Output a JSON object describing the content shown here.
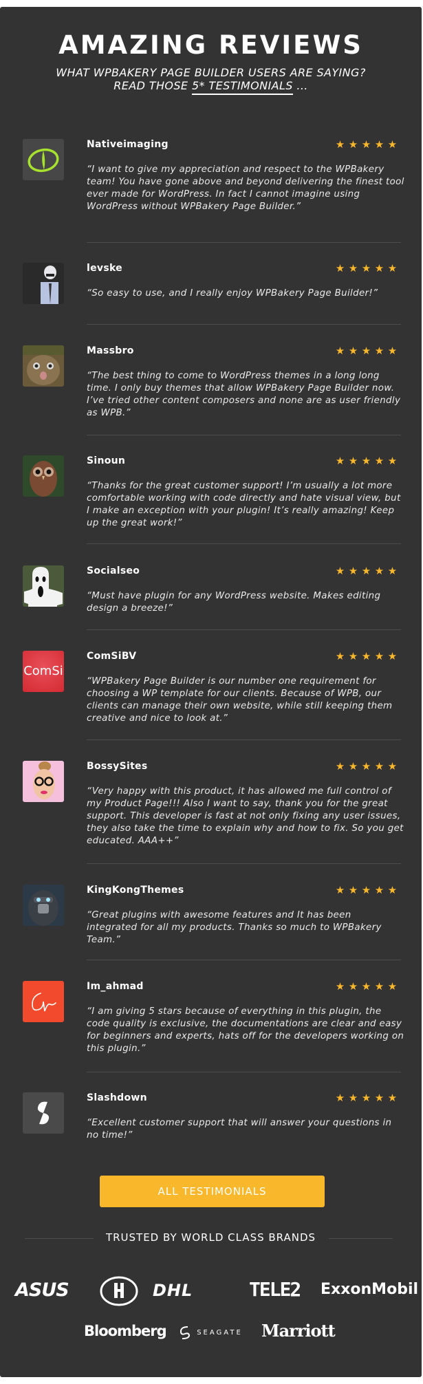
{
  "header": {
    "title": "AMAZING REVIEWS",
    "subtitle_line1": "WHAT WPBAKERY PAGE BUILDER USERS ARE SAYING?",
    "subtitle_line2_prefix": "READ THOSE ",
    "subtitle_line2_link": "5* TESTIMONIALS",
    "subtitle_line2_suffix": " ..."
  },
  "star_color": "#f9b72c",
  "reviews": [
    {
      "name": "Nativeimaging",
      "rating": 5,
      "avatar": "green-eye-logo",
      "quote": "“I want to give my appreciation and respect to the WPBakery team! You have gone above and beyond delivering the finest tool ever made for WordPress. In fact I cannot imagine using WordPress without WPBakery Page Builder.”"
    },
    {
      "name": "levske",
      "rating": 5,
      "avatar": "stormtrooper-suit-photo",
      "quote": "“So easy to use, and I really enjoy WPBakery Page Builder!”"
    },
    {
      "name": "Massbro",
      "rating": 5,
      "avatar": "animal-hat-photo",
      "quote": "“The best thing to come to WordPress themes in a long long time. I only buy themes that allow WPBakery Page Builder now. I’ve tried other content composers and none are as user friendly as WPB.”"
    },
    {
      "name": "Sinoun",
      "rating": 5,
      "avatar": "owl-photo",
      "quote": "“Thanks for the great customer support! I’m usually a lot more comfortable working with code directly and hate visual view, but I make an exception with your plugin! It’s really amazing! Keep up the great work!”"
    },
    {
      "name": "Socialseo",
      "rating": 5,
      "avatar": "ghost-photo",
      "quote": "“Must have plugin for any WordPress website. Makes editing design a breeze!”"
    },
    {
      "name": "ComSiBV",
      "rating": 5,
      "avatar": "comsi-logo",
      "avatar_text": "ComSi",
      "quote": "“WPBakery Page Builder is our number one requirement for choosing a WP template for our clients. Because of WPB, our clients can manage their own website, while still keeping them creative and nice to look at.”"
    },
    {
      "name": "BossySites",
      "rating": 5,
      "avatar": "woman-glasses-photo",
      "quote": "“Very happy with this product, it has allowed me full control of my Product Page!!! Also I want to say, thank you for the great support. This developer is fast at not only fixing any user issues, they also take the time to explain why and how to fix. So you get educated. AAA++”"
    },
    {
      "name": "KingKongThemes",
      "rating": 5,
      "avatar": "gorilla-logo",
      "quote": "“Great plugins with awesome features and It has been integrated for all my products. Thanks so much to WPBakery Team.”"
    },
    {
      "name": "Im_ahmad",
      "rating": 5,
      "avatar": "signature-logo",
      "quote": "“I am giving 5 stars because of everything in this plugin, the code quality is exclusive, the documentations are clear and easy for beginners and experts, hats off for the developers working on this plugin.”"
    },
    {
      "name": "Slashdown",
      "rating": 5,
      "avatar": "slashdown-logo",
      "quote": "“Excellent customer support that will answer your questions in no time!”"
    }
  ],
  "cta": {
    "label": "ALL TESTIMONIALS",
    "color": "#f9b72c"
  },
  "brands": {
    "heading": "TRUSTED BY WORLD CLASS BRANDS",
    "row1": [
      "ASUS",
      "Hilton",
      "DHL",
      "TELE2",
      "ExxonMobil"
    ],
    "row2": [
      "Bloomberg",
      "SEAGATE",
      "Marriott"
    ]
  }
}
